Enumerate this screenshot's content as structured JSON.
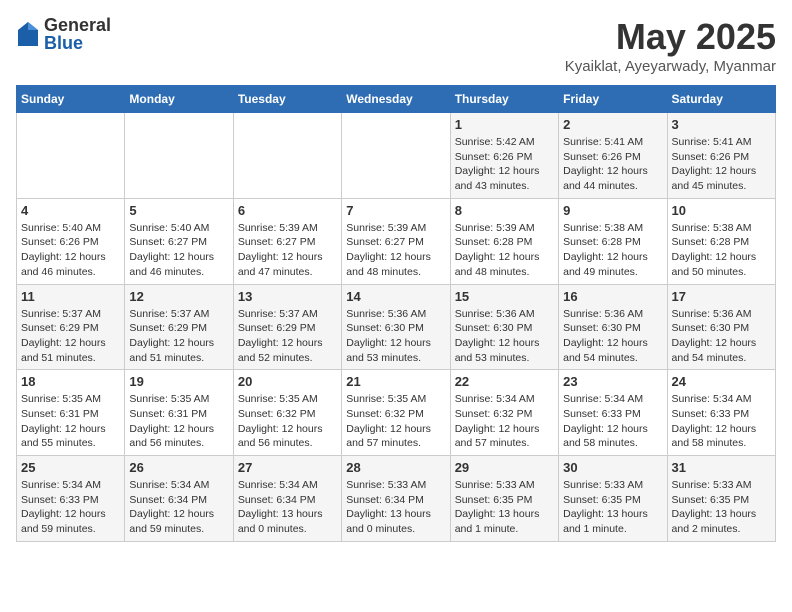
{
  "logo": {
    "general": "General",
    "blue": "Blue"
  },
  "title": {
    "month_year": "May 2025",
    "location": "Kyaiklat, Ayeyarwady, Myanmar"
  },
  "weekdays": [
    "Sunday",
    "Monday",
    "Tuesday",
    "Wednesday",
    "Thursday",
    "Friday",
    "Saturday"
  ],
  "weeks": [
    [
      {
        "day": "",
        "info": ""
      },
      {
        "day": "",
        "info": ""
      },
      {
        "day": "",
        "info": ""
      },
      {
        "day": "",
        "info": ""
      },
      {
        "day": "1",
        "info": "Sunrise: 5:42 AM\nSunset: 6:26 PM\nDaylight: 12 hours\nand 43 minutes."
      },
      {
        "day": "2",
        "info": "Sunrise: 5:41 AM\nSunset: 6:26 PM\nDaylight: 12 hours\nand 44 minutes."
      },
      {
        "day": "3",
        "info": "Sunrise: 5:41 AM\nSunset: 6:26 PM\nDaylight: 12 hours\nand 45 minutes."
      }
    ],
    [
      {
        "day": "4",
        "info": "Sunrise: 5:40 AM\nSunset: 6:26 PM\nDaylight: 12 hours\nand 46 minutes."
      },
      {
        "day": "5",
        "info": "Sunrise: 5:40 AM\nSunset: 6:27 PM\nDaylight: 12 hours\nand 46 minutes."
      },
      {
        "day": "6",
        "info": "Sunrise: 5:39 AM\nSunset: 6:27 PM\nDaylight: 12 hours\nand 47 minutes."
      },
      {
        "day": "7",
        "info": "Sunrise: 5:39 AM\nSunset: 6:27 PM\nDaylight: 12 hours\nand 48 minutes."
      },
      {
        "day": "8",
        "info": "Sunrise: 5:39 AM\nSunset: 6:28 PM\nDaylight: 12 hours\nand 48 minutes."
      },
      {
        "day": "9",
        "info": "Sunrise: 5:38 AM\nSunset: 6:28 PM\nDaylight: 12 hours\nand 49 minutes."
      },
      {
        "day": "10",
        "info": "Sunrise: 5:38 AM\nSunset: 6:28 PM\nDaylight: 12 hours\nand 50 minutes."
      }
    ],
    [
      {
        "day": "11",
        "info": "Sunrise: 5:37 AM\nSunset: 6:29 PM\nDaylight: 12 hours\nand 51 minutes."
      },
      {
        "day": "12",
        "info": "Sunrise: 5:37 AM\nSunset: 6:29 PM\nDaylight: 12 hours\nand 51 minutes."
      },
      {
        "day": "13",
        "info": "Sunrise: 5:37 AM\nSunset: 6:29 PM\nDaylight: 12 hours\nand 52 minutes."
      },
      {
        "day": "14",
        "info": "Sunrise: 5:36 AM\nSunset: 6:30 PM\nDaylight: 12 hours\nand 53 minutes."
      },
      {
        "day": "15",
        "info": "Sunrise: 5:36 AM\nSunset: 6:30 PM\nDaylight: 12 hours\nand 53 minutes."
      },
      {
        "day": "16",
        "info": "Sunrise: 5:36 AM\nSunset: 6:30 PM\nDaylight: 12 hours\nand 54 minutes."
      },
      {
        "day": "17",
        "info": "Sunrise: 5:36 AM\nSunset: 6:30 PM\nDaylight: 12 hours\nand 54 minutes."
      }
    ],
    [
      {
        "day": "18",
        "info": "Sunrise: 5:35 AM\nSunset: 6:31 PM\nDaylight: 12 hours\nand 55 minutes."
      },
      {
        "day": "19",
        "info": "Sunrise: 5:35 AM\nSunset: 6:31 PM\nDaylight: 12 hours\nand 56 minutes."
      },
      {
        "day": "20",
        "info": "Sunrise: 5:35 AM\nSunset: 6:32 PM\nDaylight: 12 hours\nand 56 minutes."
      },
      {
        "day": "21",
        "info": "Sunrise: 5:35 AM\nSunset: 6:32 PM\nDaylight: 12 hours\nand 57 minutes."
      },
      {
        "day": "22",
        "info": "Sunrise: 5:34 AM\nSunset: 6:32 PM\nDaylight: 12 hours\nand 57 minutes."
      },
      {
        "day": "23",
        "info": "Sunrise: 5:34 AM\nSunset: 6:33 PM\nDaylight: 12 hours\nand 58 minutes."
      },
      {
        "day": "24",
        "info": "Sunrise: 5:34 AM\nSunset: 6:33 PM\nDaylight: 12 hours\nand 58 minutes."
      }
    ],
    [
      {
        "day": "25",
        "info": "Sunrise: 5:34 AM\nSunset: 6:33 PM\nDaylight: 12 hours\nand 59 minutes."
      },
      {
        "day": "26",
        "info": "Sunrise: 5:34 AM\nSunset: 6:34 PM\nDaylight: 12 hours\nand 59 minutes."
      },
      {
        "day": "27",
        "info": "Sunrise: 5:34 AM\nSunset: 6:34 PM\nDaylight: 13 hours\nand 0 minutes."
      },
      {
        "day": "28",
        "info": "Sunrise: 5:33 AM\nSunset: 6:34 PM\nDaylight: 13 hours\nand 0 minutes."
      },
      {
        "day": "29",
        "info": "Sunrise: 5:33 AM\nSunset: 6:35 PM\nDaylight: 13 hours\nand 1 minute."
      },
      {
        "day": "30",
        "info": "Sunrise: 5:33 AM\nSunset: 6:35 PM\nDaylight: 13 hours\nand 1 minute."
      },
      {
        "day": "31",
        "info": "Sunrise: 5:33 AM\nSunset: 6:35 PM\nDaylight: 13 hours\nand 2 minutes."
      }
    ]
  ]
}
